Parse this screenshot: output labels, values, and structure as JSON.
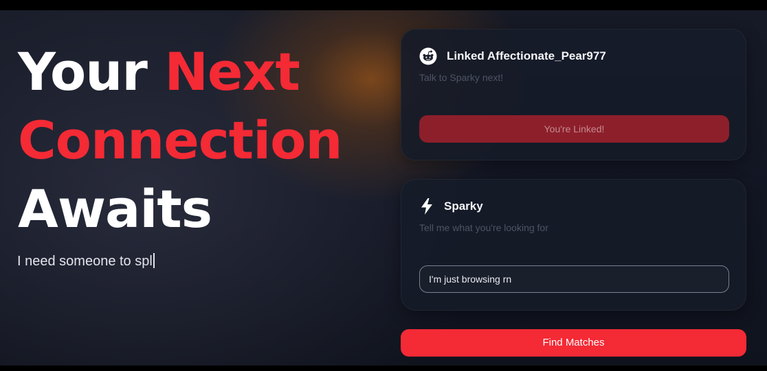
{
  "hero": {
    "headline_white_1": "Your",
    "headline_red_1": "Next",
    "headline_red_2": "Connection",
    "headline_white_2": "Awaits",
    "typed_text": "I need someone to spl"
  },
  "cards": {
    "linked": {
      "icon": "reddit-icon",
      "title": "Linked Affectionate_Pear977",
      "subtitle": "Talk to Sparky next!",
      "button_label": "You're Linked!"
    },
    "sparky": {
      "icon": "bolt-icon",
      "title": "Sparky",
      "subtitle": "Tell me what you're looking for",
      "input_value": "I'm just browsing rn"
    }
  },
  "actions": {
    "find_matches_label": "Find Matches"
  },
  "colors": {
    "accent": "#f42a35",
    "linked_button": "#8d1f2b",
    "card_background": "#161b28",
    "page_background": "#121623"
  }
}
